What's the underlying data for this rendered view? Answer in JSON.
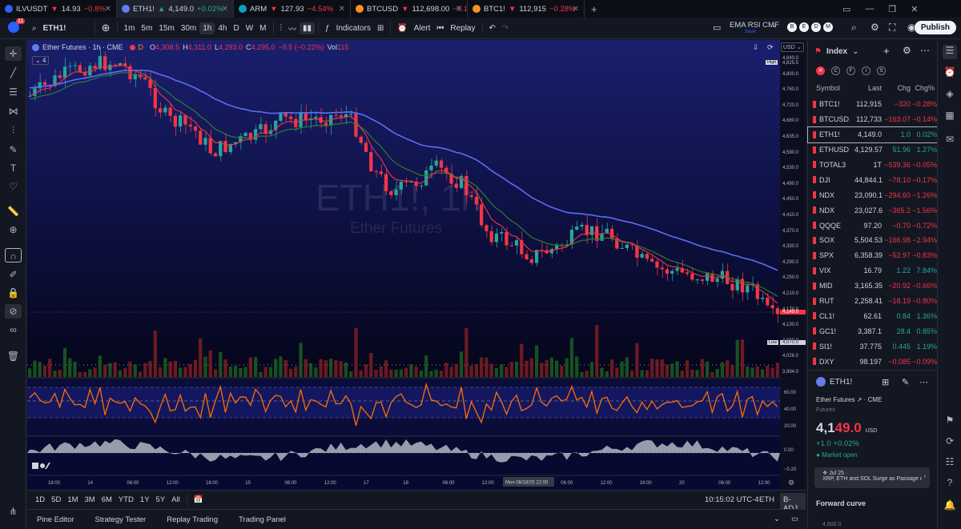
{
  "tabs": [
    {
      "symbol": "ILVUSDT",
      "arrow": "▼",
      "price": "14.93",
      "change": "−0.8%",
      "dir": "dn",
      "icon_color": "#2962ff"
    },
    {
      "symbol": "ETH1!",
      "arrow": "▲",
      "price": "4,149.0",
      "change": "+0.02%",
      "dir": "up",
      "icon_color": "#627eea"
    },
    {
      "symbol": "ARM",
      "arrow": "▼",
      "price": "127.93",
      "change": "−4.54%",
      "dir": "dn",
      "icon_color": "#0aa2c0"
    },
    {
      "symbol": "BTCUSD",
      "arrow": "▼",
      "price": "112,698.00",
      "change": "−0.1",
      "dir": "dn",
      "icon_color": "#f7931a"
    },
    {
      "symbol": "BTC1!",
      "arrow": "▼",
      "price": "112,915",
      "change": "−0.28%",
      "dir": "dn",
      "icon_color": "#f7931a"
    }
  ],
  "toolbar": {
    "badge": "11",
    "symbol": "ETH1!",
    "intervals": [
      "1m",
      "5m",
      "15m",
      "30m",
      "1h",
      "4h",
      "D",
      "W",
      "M"
    ],
    "active_interval": "1h",
    "indicators": "Indicators",
    "alert": "Alert",
    "replay": "Replay",
    "template_name": "EMA RSI CMF",
    "template_sub": "Save",
    "publish": "Publish"
  },
  "legend": {
    "title": "Ether Futures · 1h · CME",
    "ohlc": {
      "o": "4,308.5",
      "h": "4,311.0",
      "l": "4,293.0",
      "c": "4,295.0",
      "chg": "−9.5 (−0.22%)",
      "vol": "115"
    },
    "hidden_count": "4",
    "currency": "USD"
  },
  "watermark": {
    "symbol": "ETH1!, 1h",
    "name": "Ether Futures"
  },
  "price_scale": {
    "ticks": [
      "4,840.0",
      "4,800.0",
      "4,760.0",
      "4,720.0",
      "4,680.0",
      "4,635.0",
      "4,590.0",
      "4,530.0",
      "4,490.0",
      "4,450.0",
      "4,410.0",
      "4,370.0",
      "4,330.0",
      "4,290.0",
      "4,250.0",
      "4,210.0",
      "4,170.0",
      "4,130.0",
      "4,090.0",
      "4,026.0",
      "3,994.0"
    ],
    "high_label": "High",
    "high_value": "4,825.5",
    "last_price": "4,149.0",
    "low_label": "Low",
    "low_value": "4,070.0",
    "rsi_ticks": [
      "60.00",
      "40.00",
      "20.00"
    ],
    "cmf_ticks": [
      "0.00",
      "−0.20"
    ]
  },
  "time_axis": {
    "labels": [
      "18:00",
      "14",
      "06:00",
      "12:00",
      "18:00",
      "15",
      "06:00",
      "12:00",
      "17",
      "18",
      "06:00",
      "12:00",
      "18:00",
      "06:00",
      "12:00",
      "18:00",
      "20",
      "06:00",
      "12:00"
    ],
    "crosshair": "Mon 08/18/25   22:00"
  },
  "bottom": {
    "ranges": [
      "1D",
      "5D",
      "1M",
      "3M",
      "6M",
      "YTD",
      "1Y",
      "5Y",
      "All"
    ],
    "clock": "10:15:02 UTC-4",
    "session": "ETH",
    "adj": "B-ADJ"
  },
  "panels": [
    "Pine Editor",
    "Strategy Tester",
    "Replay Trading",
    "Trading Panel"
  ],
  "watchlist": {
    "title": "Index",
    "flags": [
      "C",
      "F",
      "I",
      "S"
    ],
    "headers": {
      "symbol": "Symbol",
      "last": "Last",
      "chg": "Chg",
      "chgp": "Chg%"
    },
    "rows": [
      {
        "sym": "BTC1!",
        "last": "112,915",
        "chg": "−320",
        "chgp": "−0.28%",
        "dir": "neg"
      },
      {
        "sym": "BTCUSD",
        "last": "112,733",
        "chg": "−163.07",
        "chgp": "−0.14%",
        "dir": "neg"
      },
      {
        "sym": "ETH1!",
        "last": "4,149.0",
        "chg": "1.0",
        "chgp": "0.02%",
        "dir": "pos"
      },
      {
        "sym": "ETHUSD",
        "last": "4,129.57",
        "chg": "51.96",
        "chgp": "1.27%",
        "dir": "pos"
      },
      {
        "sym": "TOTAL3",
        "last": "1T",
        "chg": "−539.36",
        "chgp": "−0.05%",
        "dir": "neg"
      },
      {
        "sym": "DJI",
        "last": "44,844.1",
        "chg": "−78.10",
        "chgp": "−0.17%",
        "dir": "neg"
      },
      {
        "sym": "NDX",
        "last": "23,090.1",
        "chg": "−294.60",
        "chgp": "−1.26%",
        "dir": "neg"
      },
      {
        "sym": "NDX",
        "last": "23,027.6",
        "chg": "−365.2",
        "chgp": "−1.56%",
        "dir": "neg"
      },
      {
        "sym": "QQQE",
        "last": "97.20",
        "chg": "−0.70",
        "chgp": "−0.72%",
        "dir": "neg"
      },
      {
        "sym": "SOX",
        "last": "5,504.53",
        "chg": "−166.98",
        "chgp": "−2.94%",
        "dir": "neg"
      },
      {
        "sym": "SPX",
        "last": "6,358.39",
        "chg": "−52.97",
        "chgp": "−0.83%",
        "dir": "neg"
      },
      {
        "sym": "VIX",
        "last": "16.79",
        "chg": "1.22",
        "chgp": "7.84%",
        "dir": "pos"
      },
      {
        "sym": "MID",
        "last": "3,165.35",
        "chg": "−20.92",
        "chgp": "−0.66%",
        "dir": "neg"
      },
      {
        "sym": "RUT",
        "last": "2,258.41",
        "chg": "−18.19",
        "chgp": "−0.80%",
        "dir": "neg"
      },
      {
        "sym": "CL1!",
        "last": "62.61",
        "chg": "0.84",
        "chgp": "1.36%",
        "dir": "pos"
      },
      {
        "sym": "GC1!",
        "last": "3,387.1",
        "chg": "28.4",
        "chgp": "0.85%",
        "dir": "pos"
      },
      {
        "sym": "SI1!",
        "last": "37.775",
        "chg": "0.445",
        "chgp": "1.19%",
        "dir": "pos"
      },
      {
        "sym": "DXY",
        "last": "98.197",
        "chg": "−0.085",
        "chgp": "−0.09%",
        "dir": "neg"
      }
    ],
    "detail": {
      "symbol": "ETH1!",
      "name": "Ether Futures",
      "exchange": "CME",
      "type": "Futures",
      "price_main": "4,1",
      "price_tail": "49.0",
      "currency": "USD",
      "change": "+1.0  +0.02%",
      "market": "Market open",
      "news_date": "Jul 25",
      "news_text": "XRP, ETH and SOL Surge as Passage of GENIUS Bi...",
      "forward": "Forward curve",
      "forward_tick": "4,600.0"
    }
  },
  "colors": {
    "up": "#26a69a",
    "down": "#f23645",
    "ema_fast": "#f23645",
    "ema_mid": "#2e7d32",
    "ema_slow": "#5b6ef5",
    "rsi": "#ff6d00"
  }
}
